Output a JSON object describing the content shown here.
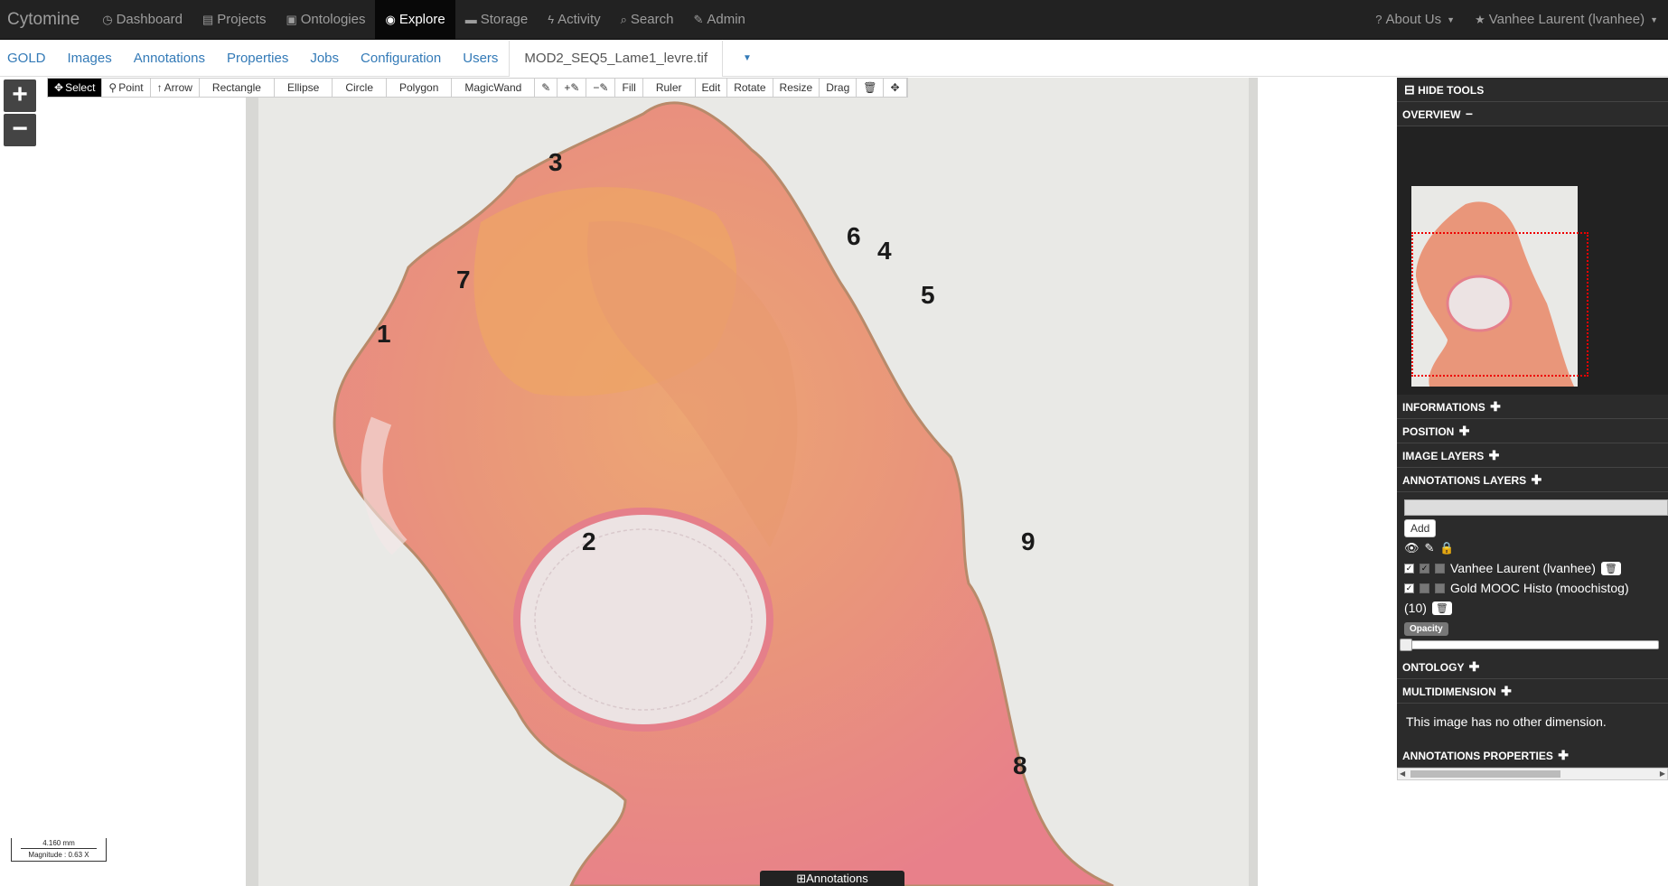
{
  "navbar": {
    "brand": "Cytomine",
    "items": [
      {
        "label": "Dashboard",
        "icon": "dashboard-icon",
        "glyph": "◷"
      },
      {
        "label": "Projects",
        "icon": "projects-icon",
        "glyph": "▤"
      },
      {
        "label": "Ontologies",
        "icon": "ontologies-icon",
        "glyph": "▣"
      },
      {
        "label": "Explore",
        "icon": "eye-icon",
        "glyph": "◉",
        "active": true
      },
      {
        "label": "Storage",
        "icon": "storage-icon",
        "glyph": "▬"
      },
      {
        "label": "Activity",
        "icon": "activity-icon",
        "glyph": "ϟ"
      },
      {
        "label": "Search",
        "icon": "search-icon",
        "glyph": "⌕"
      },
      {
        "label": "Admin",
        "icon": "wrench-icon",
        "glyph": "✎"
      }
    ],
    "about": "About Us",
    "user": "Vanhee Laurent (lvanhee)"
  },
  "subnav": {
    "tabs": [
      "GOLD",
      "Images",
      "Annotations",
      "Properties",
      "Jobs",
      "Configuration",
      "Users"
    ],
    "image_tab": "MOD2_SEQ5_Lame1_levre.tif"
  },
  "toolbar": {
    "tools": [
      "Select",
      "Point",
      "Arrow",
      "Rectangle",
      "Ellipse",
      "Circle",
      "Polygon",
      "MagicWand",
      "Fill",
      "Ruler",
      "Edit",
      "Rotate",
      "Resize",
      "Drag"
    ]
  },
  "viewer": {
    "zoom_in": "+",
    "zoom_out": "−",
    "labels": [
      "1",
      "2",
      "3",
      "4",
      "5",
      "6",
      "7",
      "8",
      "9"
    ],
    "scale_length": "4.160 mm",
    "scale_magnitude": "Magnitude : 0.63 X",
    "annotations_tab": "Annotations"
  },
  "panel": {
    "hide_tools": "HIDE TOOLS",
    "overview": "OVERVIEW",
    "informations": "INFORMATIONS",
    "position": "POSITION",
    "image_layers": "IMAGE LAYERS",
    "annotations_layers": "ANNOTATIONS LAYERS",
    "add_button": "Add",
    "layers": [
      {
        "name": "Vanhee Laurent (lvanhee)"
      },
      {
        "name": "Gold MOOC Histo (moochistog)",
        "count": "(10)"
      }
    ],
    "opacity": "Opacity",
    "ontology": "ONTOLOGY",
    "multidimension": "MULTIDIMENSION",
    "multidimension_text": "This image has no other dimension.",
    "annotations_properties": "ANNOTATIONS PROPERTIES"
  }
}
